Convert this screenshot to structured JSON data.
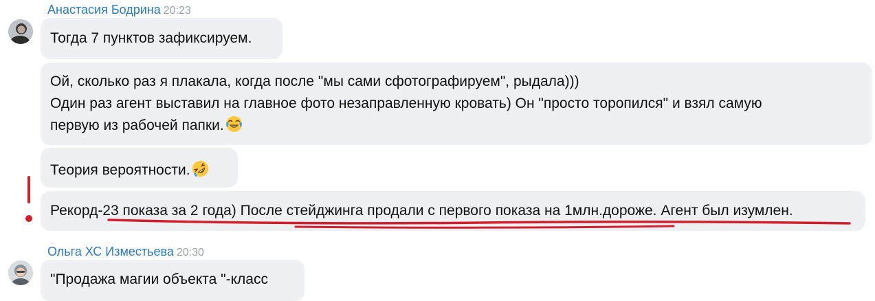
{
  "messages": [
    {
      "sender": "Анастасия Бодрина",
      "time": "20:23",
      "bubbles": [
        {
          "lines": [
            "Тогда 7 пунктов зафиксируем."
          ]
        },
        {
          "lines": [
            "Ой, сколько раз я плакала, когда после \"мы сами сфотографируем\", рыдала)))",
            "Один раз агент выставил на главное фото незаправленную кровать)  Он \"просто торопился\" и взял самую",
            "первую из рабочей папки."
          ],
          "emoji": "face-with-tears-of-joy"
        },
        {
          "lines": [
            "Теория вероятности."
          ],
          "emoji": "rolling-on-floor-laughing"
        },
        {
          "lines": [
            "Рекорд-23 показа за 2 года) После стейджинга продали с первого показа на 1млн.дороже. Агент был изумлен."
          ]
        }
      ]
    },
    {
      "sender": "Ольга ХС Изместьева",
      "time": "20:30",
      "bubbles": [
        {
          "lines": [
            "\"Продажа магии объекта \"-класс"
          ]
        }
      ]
    }
  ],
  "colors": {
    "sender_name": "#2a7bbf",
    "timestamp": "#9aa0a6",
    "bubble_bg": "#eef0f4",
    "annotation": "#d0202e"
  },
  "icons": {
    "avatar_1": "avatar",
    "avatar_2": "avatar",
    "emoji_1": "face-with-tears-of-joy-icon",
    "emoji_2": "rolling-on-floor-laughing-icon"
  }
}
